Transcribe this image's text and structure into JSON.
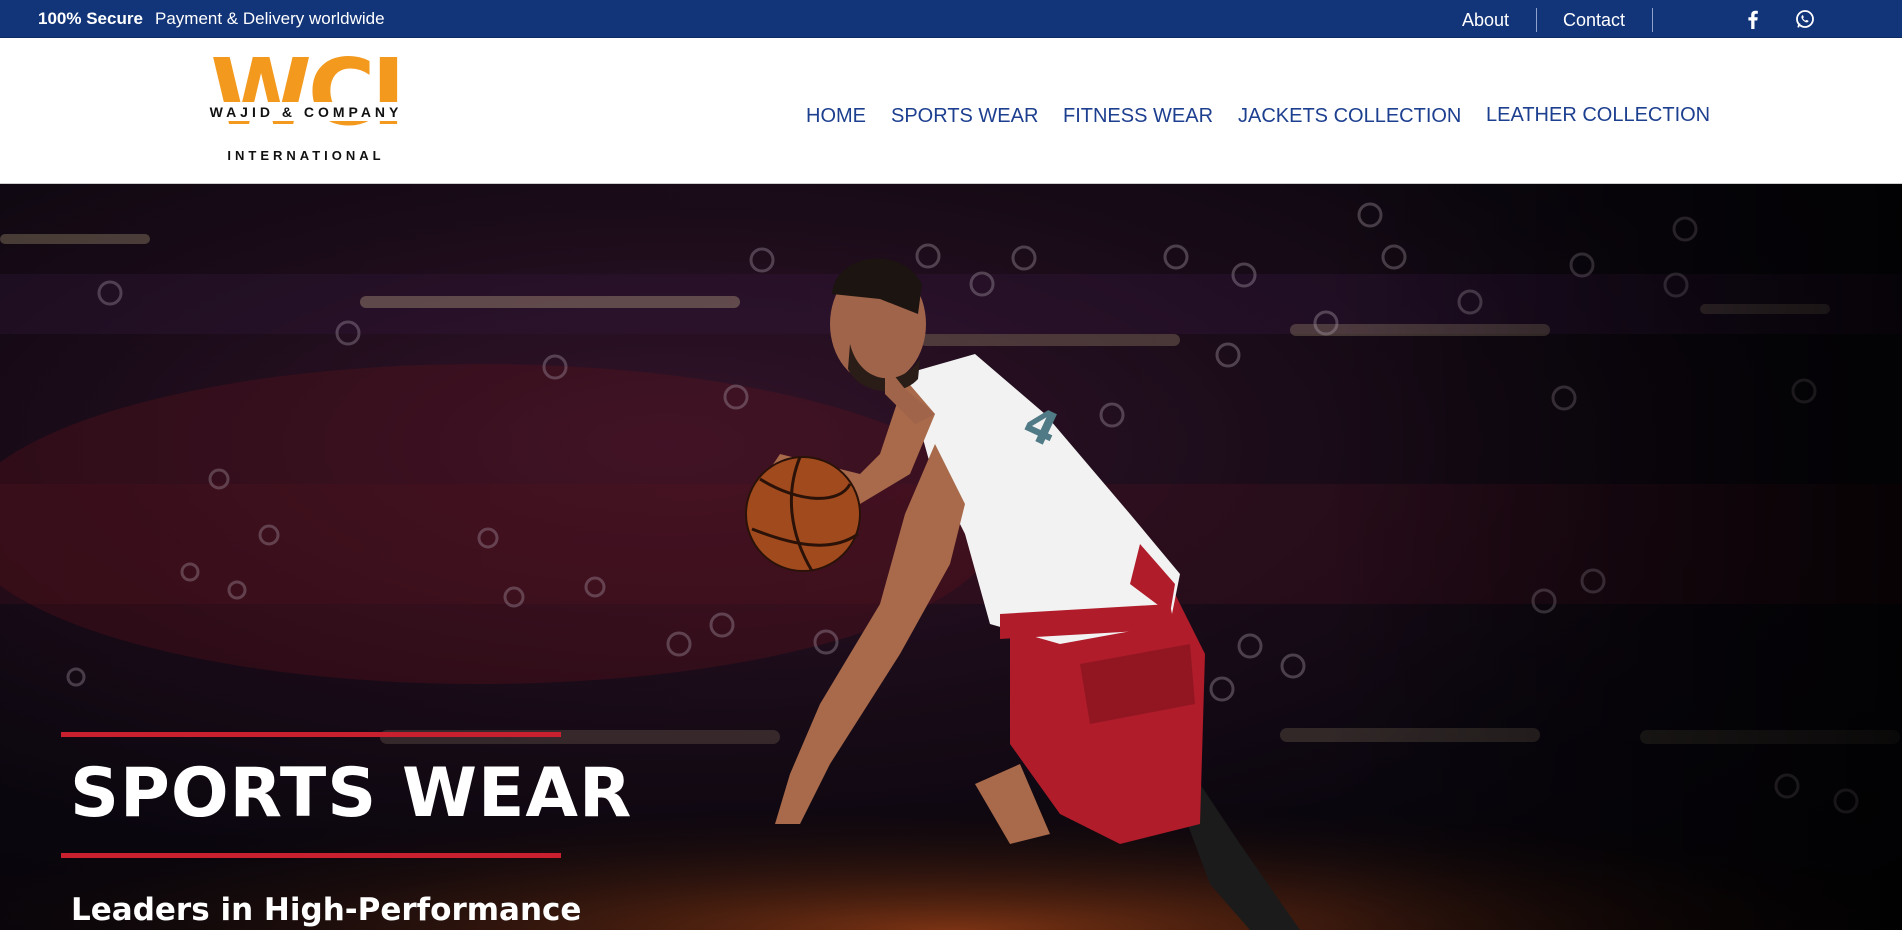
{
  "topbar": {
    "secure_label": "100% Secure",
    "secure_sub": "Payment & Delivery worldwide",
    "links": {
      "about": "About",
      "contact": "Contact"
    },
    "social_icons": [
      "facebook-icon",
      "whatsapp-icon"
    ]
  },
  "logo": {
    "mark": "WCI",
    "line1": "WAJID & COMPANY",
    "line2": "INTERNATIONAL"
  },
  "nav": {
    "home": "HOME",
    "sports": "SPORTS WEAR",
    "fitness": "FITNESS WEAR",
    "jackets": "JACKETS COLLECTION",
    "leather": "LEATHER COLLECTION"
  },
  "hero": {
    "title": "SPORTS WEAR",
    "subtitle": "Leaders in High-Performance"
  },
  "colors": {
    "topbar_bg": "#123478",
    "nav_text": "#1d3f8f",
    "logo_orange": "#f39a1e",
    "accent_red": "#c8202e",
    "hero_dark": "#0b0710"
  }
}
